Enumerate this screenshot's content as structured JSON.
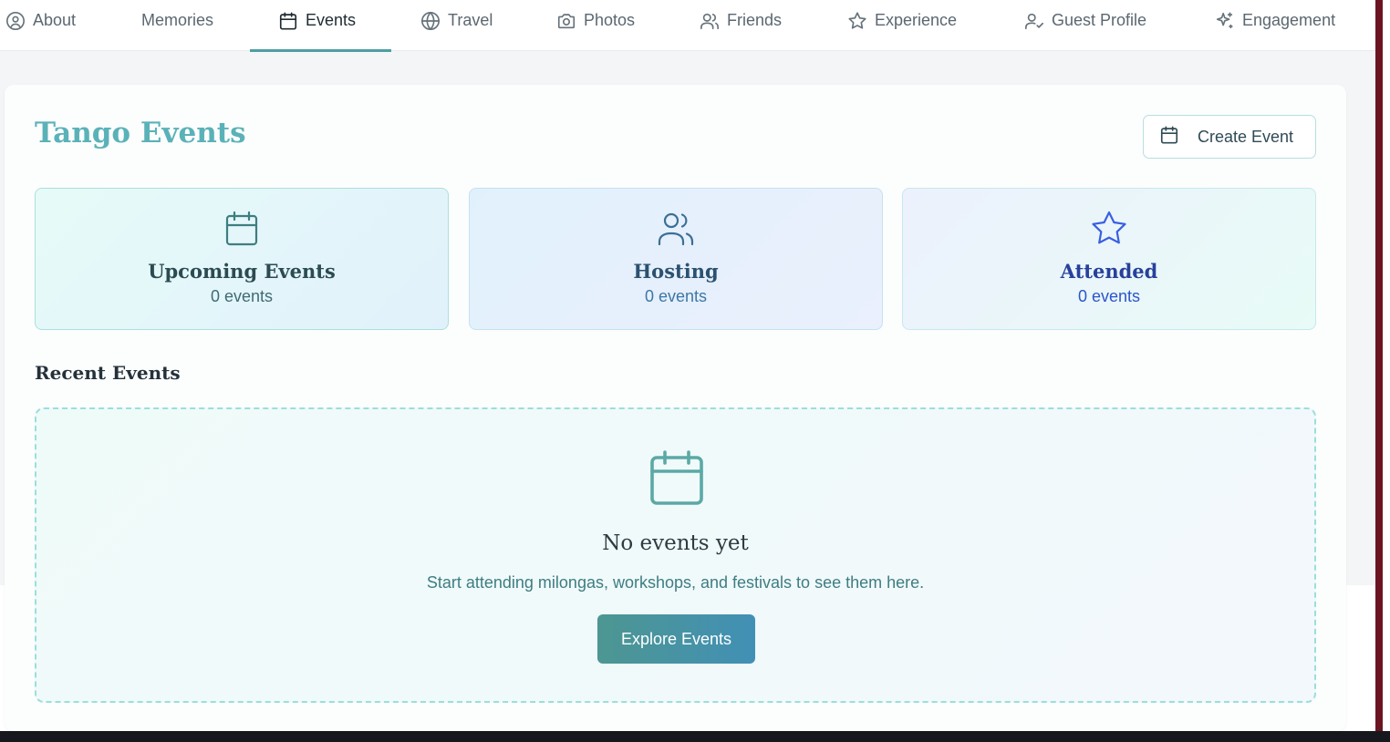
{
  "tabs": [
    {
      "label": "About",
      "icon": "user-circle-icon"
    },
    {
      "label": "Memories",
      "icon": ""
    },
    {
      "label": "Events",
      "icon": "calendar-icon",
      "active": true
    },
    {
      "label": "Travel",
      "icon": "globe-icon"
    },
    {
      "label": "Photos",
      "icon": "camera-icon"
    },
    {
      "label": "Friends",
      "icon": "users-icon"
    },
    {
      "label": "Experience",
      "icon": "star-icon"
    },
    {
      "label": "Guest Profile",
      "icon": "user-check-icon"
    },
    {
      "label": "Engagement",
      "icon": "sparkles-icon"
    }
  ],
  "header": {
    "title": "Tango Events",
    "create_button": "Create Event"
  },
  "stats": [
    {
      "title": "Upcoming Events",
      "count": "0 events",
      "icon": "calendar-icon"
    },
    {
      "title": "Hosting",
      "count": "0 events",
      "icon": "users-icon"
    },
    {
      "title": "Attended",
      "count": "0 events",
      "icon": "star-icon"
    }
  ],
  "recent": {
    "section_title": "Recent Events",
    "empty_title": "No events yet",
    "empty_subtitle": "Start attending milongas, workshops, and festivals to see them here.",
    "explore_button": "Explore Events"
  },
  "colors": {
    "accent": "#5ab2b8",
    "tab_active_underline": "#4e9ea3",
    "explore_button_start": "#4d9692",
    "explore_button_end": "#4190b5"
  }
}
